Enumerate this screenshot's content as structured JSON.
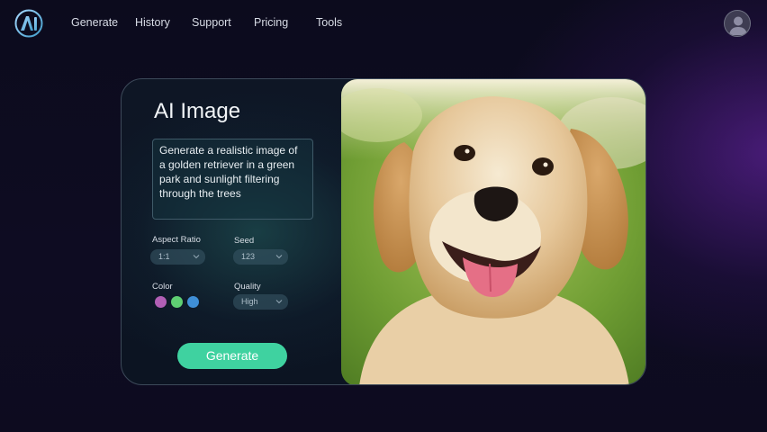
{
  "nav": {
    "logo_text": "AI",
    "items": [
      "Generate",
      "History",
      "Support",
      "Pricing",
      "Tools"
    ]
  },
  "generator": {
    "title": "AI Image",
    "prompt": "Generate a realistic image of a golden retriever in a green park and sunlight filtering through the trees",
    "aspect_ratio": {
      "label": "Aspect Ratio",
      "value": "1:1"
    },
    "seed": {
      "label": "Seed",
      "value": "123"
    },
    "color": {
      "label": "Color",
      "swatches": [
        "#b15fb5",
        "#5fcf73",
        "#3f8fd6"
      ]
    },
    "quality": {
      "label": "Quality",
      "value": "High"
    },
    "generate_label": "Generate"
  },
  "colors": {
    "accent": "#3fd2a0",
    "background": "#0d0b1f"
  },
  "icons": [
    "logo-icon",
    "user-avatar-icon",
    "chevron-down-icon"
  ]
}
